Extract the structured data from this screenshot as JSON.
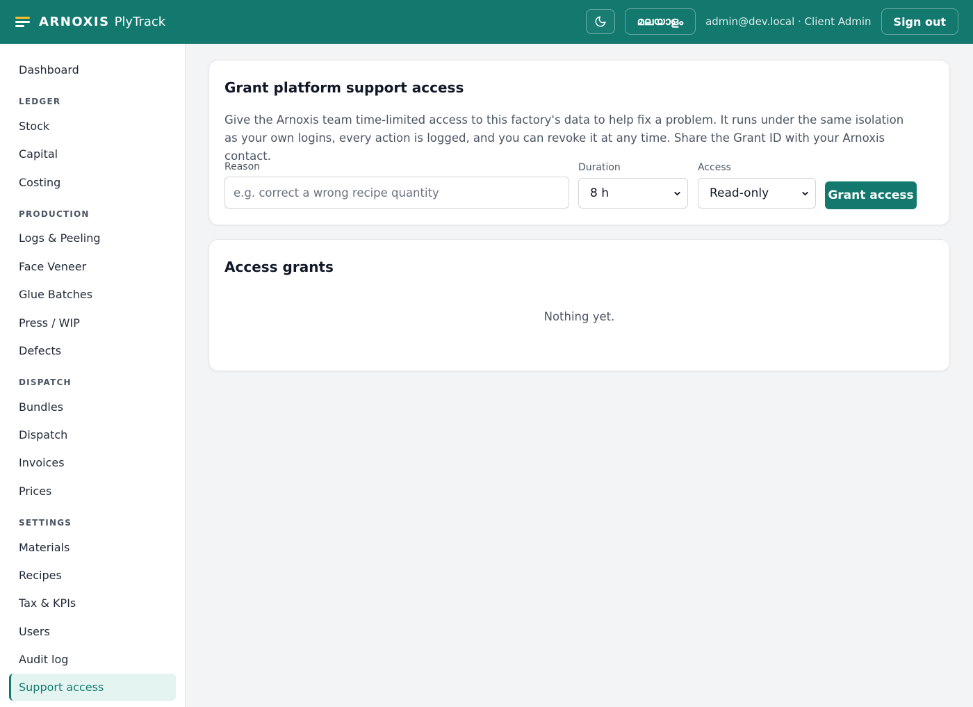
{
  "header": {
    "brand_name": "ARNOXIS",
    "product": "PlyTrack",
    "theme_icon": "moon-icon",
    "language": "മലയാളം",
    "user": "admin@dev.local · Client Admin",
    "sign_out": "Sign out"
  },
  "sidebar": {
    "dashboard": "Dashboard",
    "sections": [
      {
        "title": "LEDGER",
        "items": [
          "Stock",
          "Capital",
          "Costing"
        ]
      },
      {
        "title": "PRODUCTION",
        "items": [
          "Logs & Peeling",
          "Face Veneer",
          "Glue Batches",
          "Press / WIP",
          "Defects"
        ]
      },
      {
        "title": "DISPATCH",
        "items": [
          "Bundles",
          "Dispatch",
          "Invoices",
          "Prices"
        ]
      },
      {
        "title": "SETTINGS",
        "items": [
          "Materials",
          "Recipes",
          "Tax & KPIs",
          "Users",
          "Audit log",
          "Support access"
        ]
      }
    ],
    "active": "Support access"
  },
  "grant": {
    "title": "Grant platform support access",
    "description": "Give the Arnoxis team time-limited access to this factory's data to help fix a problem. It runs under the same isolation as your own logins, every action is logged, and you can revoke it at any time. Share the Grant ID with your Arnoxis contact.",
    "reason_label": "Reason",
    "reason_placeholder": "e.g. correct a wrong recipe quantity",
    "duration_label": "Duration",
    "duration_value": "8 h",
    "access_label": "Access",
    "access_value": "Read-only",
    "button": "Grant access"
  },
  "grants": {
    "title": "Access grants",
    "empty": "Nothing yet."
  },
  "colors": {
    "primary": "#13796f",
    "accent": "#fbbf24",
    "active_bg": "#e3f4f1"
  }
}
